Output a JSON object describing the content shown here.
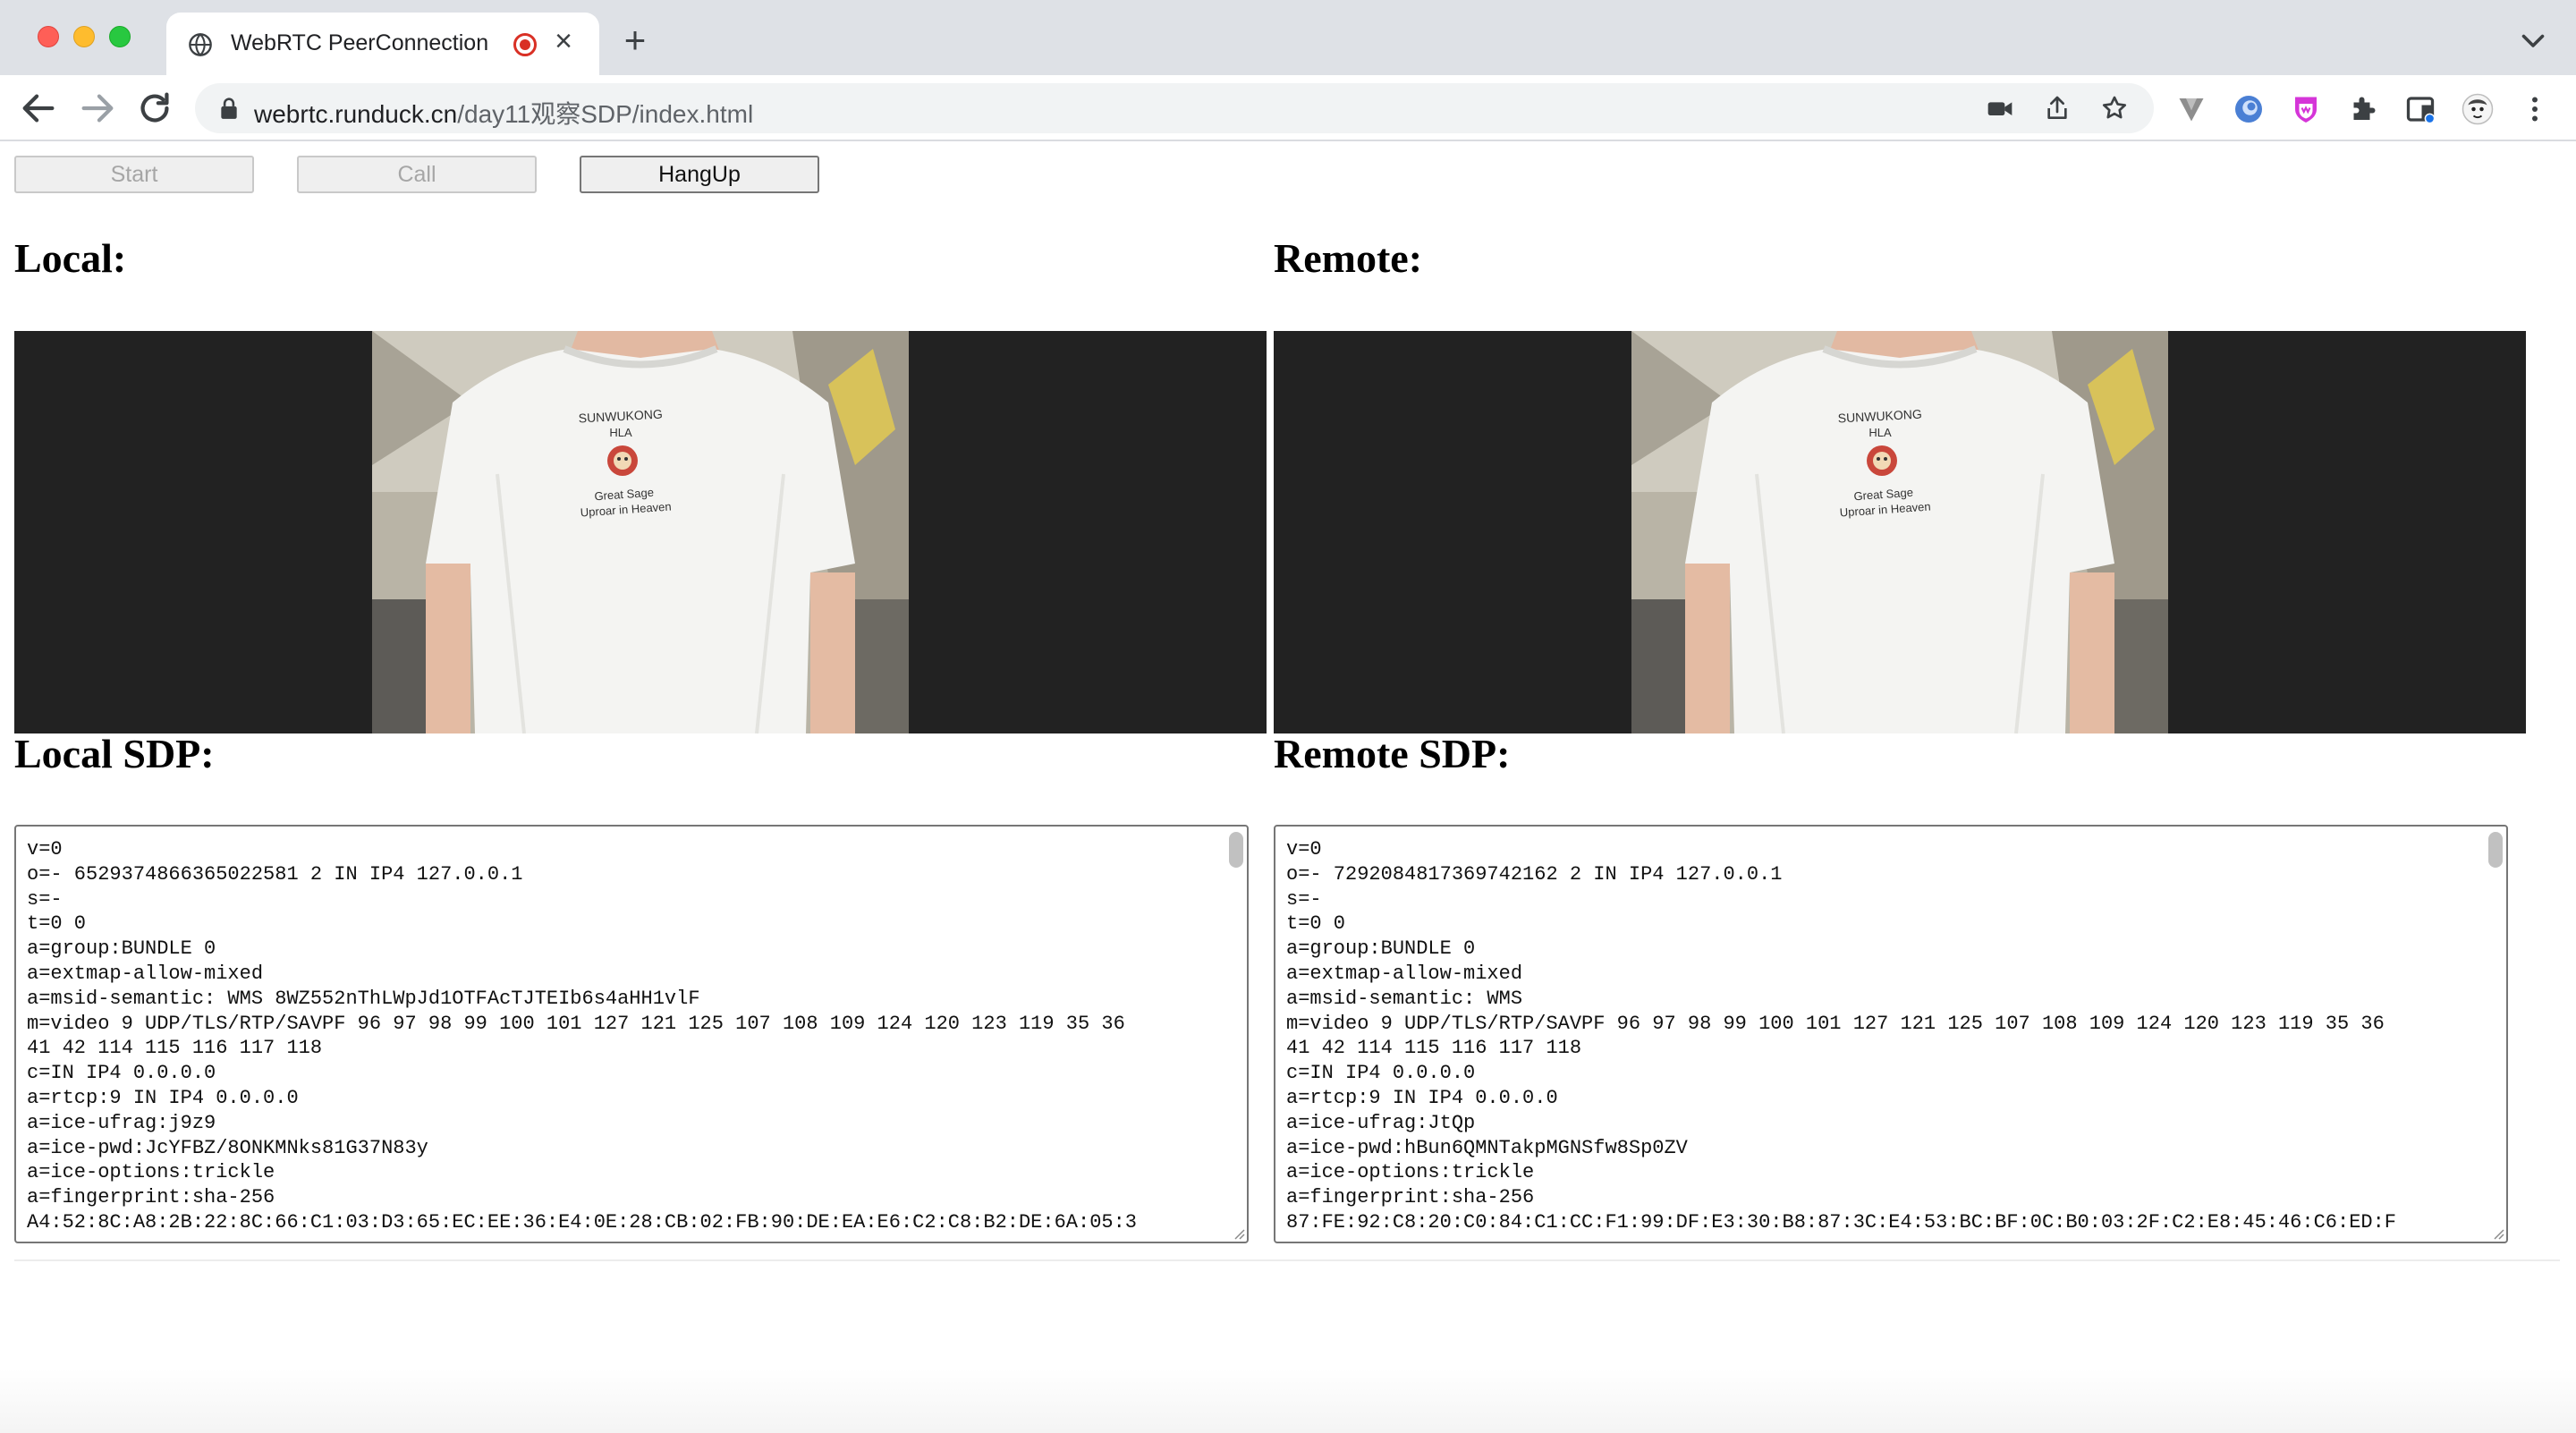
{
  "browser": {
    "tab": {
      "title": "WebRTC PeerConnection"
    },
    "address_bar": {
      "host": "webrtc.runduck.cn",
      "path": "/day11观察SDP/index.html"
    },
    "icons": [
      "globe-icon",
      "recording-icon",
      "close-icon",
      "new-tab-icon",
      "tab-search-icon",
      "back-icon",
      "forward-icon",
      "reload-icon",
      "lock-icon",
      "camera-icon",
      "share-icon",
      "bookmark-star-icon",
      "extension-v-icon",
      "extension-circle-icon",
      "extension-shield-icon",
      "puzzle-icon",
      "sidebar-icon",
      "avatar-icon",
      "kebab-menu-icon"
    ]
  },
  "controls": {
    "start_label": "Start",
    "call_label": "Call",
    "hangup_label": "HangUp"
  },
  "local": {
    "heading": "Local:",
    "sdp_heading": "Local SDP:",
    "shirt_lines": [
      "SUNWUKONG",
      "HLA",
      "Great Sage",
      "Uproar in Heaven"
    ],
    "sdp": "v=0\no=- 6529374866365022581 2 IN IP4 127.0.0.1\ns=-\nt=0 0\na=group:BUNDLE 0\na=extmap-allow-mixed\na=msid-semantic: WMS 8WZ552nThLWpJd1OTFAcTJTEIb6s4aHH1vlF\nm=video 9 UDP/TLS/RTP/SAVPF 96 97 98 99 100 101 127 121 125 107 108 109 124 120 123 119 35 36\n41 42 114 115 116 117 118\nc=IN IP4 0.0.0.0\na=rtcp:9 IN IP4 0.0.0.0\na=ice-ufrag:j9z9\na=ice-pwd:JcYFBZ/8ONKMNks81G37N83y\na=ice-options:trickle\na=fingerprint:sha-256\nA4:52:8C:A8:2B:22:8C:66:C1:03:D3:65:EC:EE:36:E4:0E:28:CB:02:FB:90:DE:EA:E6:C2:C8:B2:DE:6A:05:3"
  },
  "remote": {
    "heading": "Remote:",
    "sdp_heading": "Remote SDP:",
    "shirt_lines": [
      "SUNWUKONG",
      "HLA",
      "Great Sage",
      "Uproar in Heaven"
    ],
    "sdp": "v=0\no=- 7292084817369742162 2 IN IP4 127.0.0.1\ns=-\nt=0 0\na=group:BUNDLE 0\na=extmap-allow-mixed\na=msid-semantic: WMS\nm=video 9 UDP/TLS/RTP/SAVPF 96 97 98 99 100 101 127 121 125 107 108 109 124 120 123 119 35 36\n41 42 114 115 116 117 118\nc=IN IP4 0.0.0.0\na=rtcp:9 IN IP4 0.0.0.0\na=ice-ufrag:JtQp\na=ice-pwd:hBun6QMNTakpMGNSfw8Sp0ZV\na=ice-options:trickle\na=fingerprint:sha-256\n87:FE:92:C8:20:C0:84:C1:CC:F1:99:DF:E3:30:B8:87:3C:E4:53:BC:BF:0C:B0:03:2F:C2:E8:45:46:C6:ED:F"
  },
  "colors": {
    "chrome_bg": "#dee1e6",
    "video_letterbox": "#222222",
    "record_red": "#d93025"
  }
}
